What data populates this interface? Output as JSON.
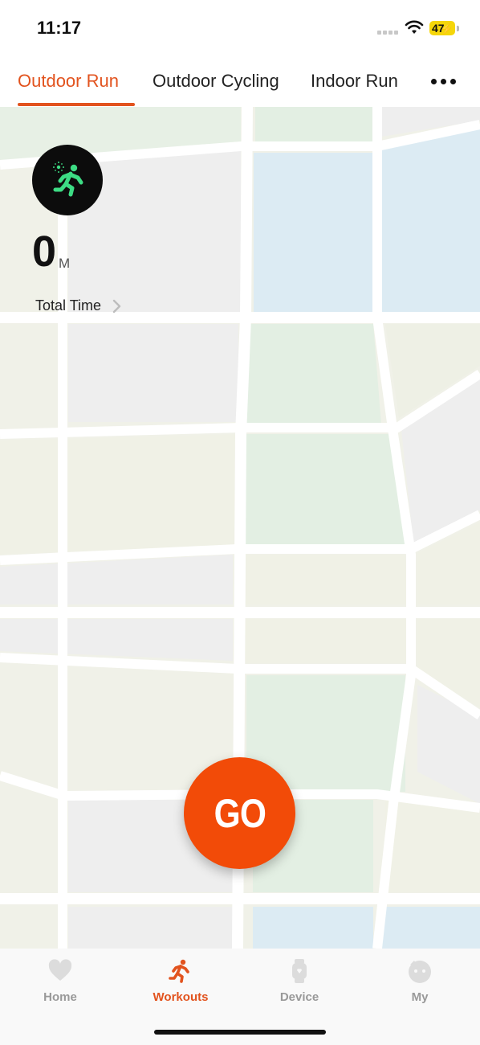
{
  "status": {
    "time": "11:17",
    "battery": "47",
    "icons": [
      "signal-dots-icon",
      "wifi-icon",
      "battery-icon",
      "charging-bolt-icon"
    ]
  },
  "tabs": {
    "items": [
      {
        "label": "Outdoor Run",
        "active": true
      },
      {
        "label": "Outdoor Cycling",
        "active": false
      },
      {
        "label": "Indoor Run",
        "active": false
      }
    ],
    "more_icon": "more-dots-icon"
  },
  "workout": {
    "badge_icon": "running-person-icon",
    "distance_value": "0",
    "distance_unit": "M",
    "total_time_label": "Total Time"
  },
  "go_button": {
    "label": "GO"
  },
  "bottom_nav": {
    "items": [
      {
        "label": "Home",
        "icon": "heart-icon",
        "active": false
      },
      {
        "label": "Workouts",
        "icon": "running-icon",
        "active": true
      },
      {
        "label": "Device",
        "icon": "watch-icon",
        "active": false
      },
      {
        "label": "My",
        "icon": "profile-icon",
        "active": false
      }
    ]
  },
  "colors": {
    "accent": "#e2531e",
    "go_button": "#f24b08",
    "badge_bg": "#0c0c0c",
    "runner_green": "#3ddc84",
    "battery": "#f5d60b",
    "inactive_nav": "#999999"
  }
}
